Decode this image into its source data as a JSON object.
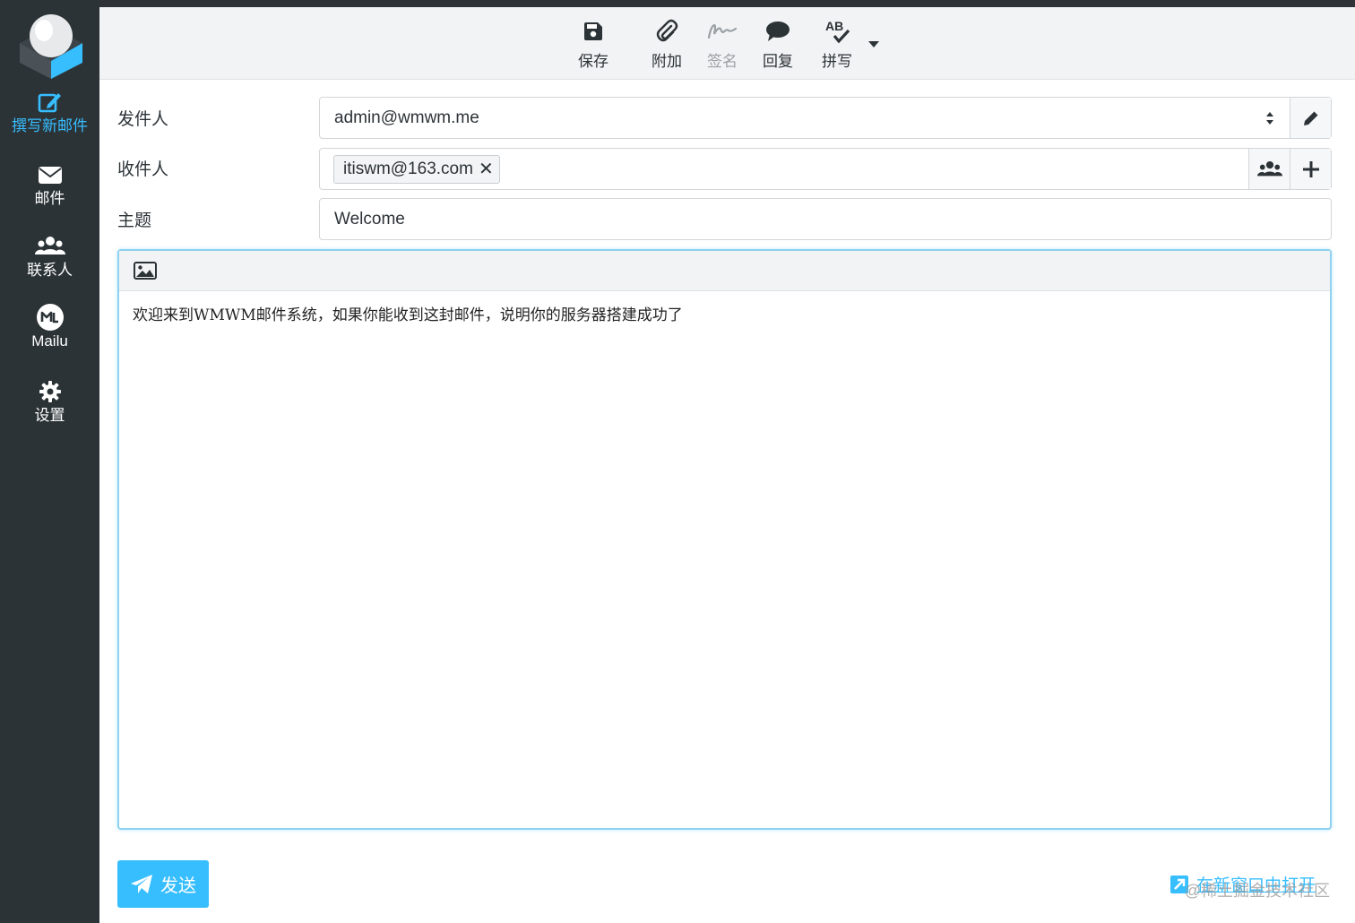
{
  "sidebar": {
    "items": [
      {
        "label": "撰写新邮件",
        "icon": "compose-icon",
        "active": true
      },
      {
        "label": "邮件",
        "icon": "envelope-icon",
        "active": false
      },
      {
        "label": "联系人",
        "icon": "users-icon",
        "active": false
      },
      {
        "label": "Mailu",
        "icon": "mailu-icon",
        "active": false
      },
      {
        "label": "设置",
        "icon": "gear-icon",
        "active": false
      }
    ]
  },
  "toolbar": {
    "save": "保存",
    "attach": "附加",
    "signature": "签名",
    "reply": "回复",
    "spell": "拼写",
    "spell_icon_text": "AB"
  },
  "compose": {
    "from_label": "发件人",
    "from_value": "admin@wmwm.me",
    "to_label": "收件人",
    "to_recipients": [
      "itiswm@163.com"
    ],
    "subject_label": "主题",
    "subject_value": "Welcome",
    "body": "欢迎来到WMWM邮件系统，如果你能收到这封邮件，说明你的服务器搭建成功了"
  },
  "actions": {
    "send": "发送",
    "open_new_window": "在新窗口中打开"
  },
  "watermark": "@稀土掘金技术社区",
  "colors": {
    "accent": "#37beff",
    "sidebar_bg": "#2c3337",
    "toolbar_bg": "#f2f3f4"
  }
}
